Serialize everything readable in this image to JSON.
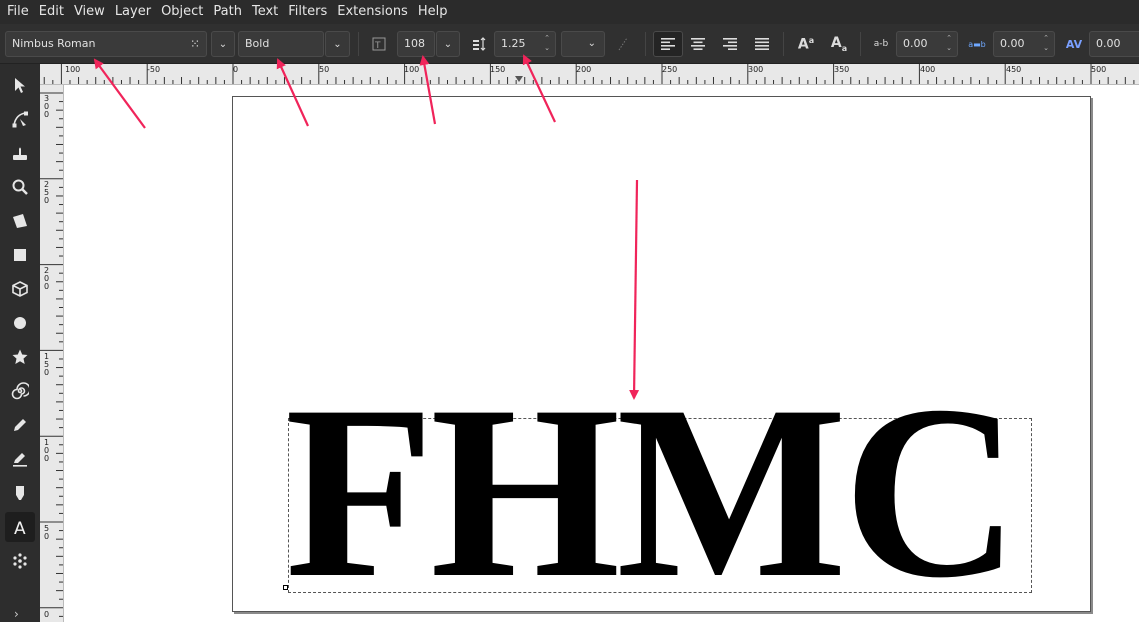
{
  "menubar": {
    "items": [
      "File",
      "Edit",
      "View",
      "Layer",
      "Object",
      "Path",
      "Text",
      "Filters",
      "Extensions",
      "Help"
    ]
  },
  "text_toolbar": {
    "font_family": "Nimbus Roman",
    "font_style": "Bold",
    "font_size": "108",
    "line_height": "1.25",
    "letter_spacing": "0.00",
    "word_spacing": "0.00",
    "kerning": "0.00"
  },
  "ruler": {
    "h_labels": [
      "100",
      "-50",
      "0",
      "50",
      "100",
      "150",
      "200",
      "250",
      "300",
      "350",
      "400",
      "450",
      "500"
    ],
    "v_labels": [
      "300",
      "250",
      "200",
      "150",
      "100",
      "50",
      "0"
    ]
  },
  "canvas": {
    "text": "FHMC"
  },
  "colors": {
    "annotation_arrow": "#f0245a",
    "ui_background": "#2d2d2d",
    "canvas": "#ffffff"
  }
}
